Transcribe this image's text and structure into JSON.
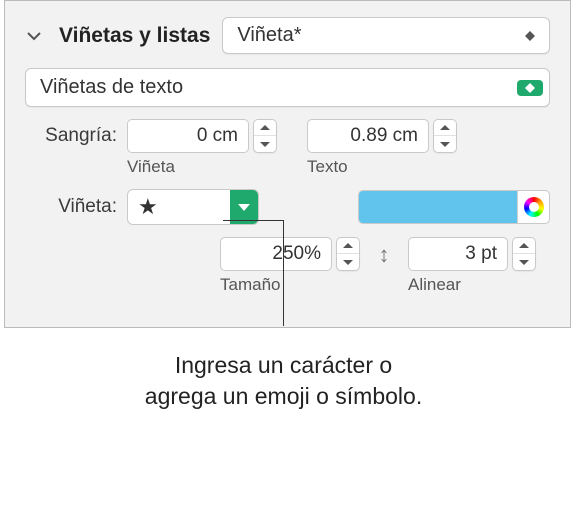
{
  "header": {
    "section_title": "Viñetas y listas",
    "style_popup": "Viñeta*"
  },
  "type_popup": "Viñetas de texto",
  "indent": {
    "label": "Sangría:",
    "bullet_value": "0 cm",
    "bullet_sub": "Viñeta",
    "text_value": "0.89 cm",
    "text_sub": "Texto"
  },
  "bullet": {
    "label": "Viñeta:",
    "symbol": "★",
    "color": "#61c4ec"
  },
  "size": {
    "value": "250%",
    "sub": "Tamaño"
  },
  "align": {
    "value": "3 pt",
    "sub": "Alinear"
  },
  "caption": {
    "line1": "Ingresa un carácter o",
    "line2": "agrega un emoji o símbolo."
  }
}
